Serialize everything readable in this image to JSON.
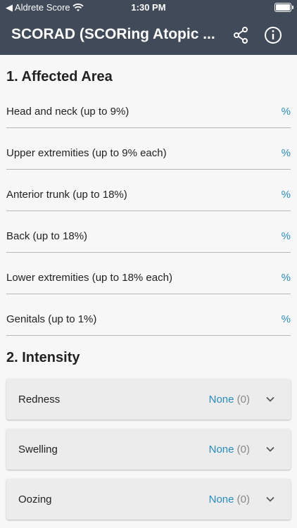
{
  "status_bar": {
    "back_app": "◀ Aldrete Score",
    "time": "1:30 PM"
  },
  "app_bar": {
    "title": "SCORAD (SCORing Atopic ...",
    "icons": [
      "share-icon",
      "info-icon"
    ]
  },
  "sections": {
    "affected_area": {
      "title": "1. Affected Area",
      "unit": "%",
      "rows": [
        {
          "label": "Head and neck (up to 9%)"
        },
        {
          "label": "Upper extremities (up to 9% each)"
        },
        {
          "label": "Anterior trunk (up to 18%)"
        },
        {
          "label": "Back (up to 18%)"
        },
        {
          "label": "Lower extremities (up to 18% each)"
        },
        {
          "label": "Genitals (up to 1%)"
        }
      ]
    },
    "intensity": {
      "title": "2. Intensity",
      "items": [
        {
          "label": "Redness",
          "value_text": "None",
          "value_num": "(0)"
        },
        {
          "label": "Swelling",
          "value_text": "None",
          "value_num": "(0)"
        },
        {
          "label": "Oozing",
          "value_text": "None",
          "value_num": "(0)"
        }
      ]
    }
  },
  "colors": {
    "app_bar": "#414a58",
    "accent": "#2a8bbd",
    "background": "#f7f7f7"
  }
}
